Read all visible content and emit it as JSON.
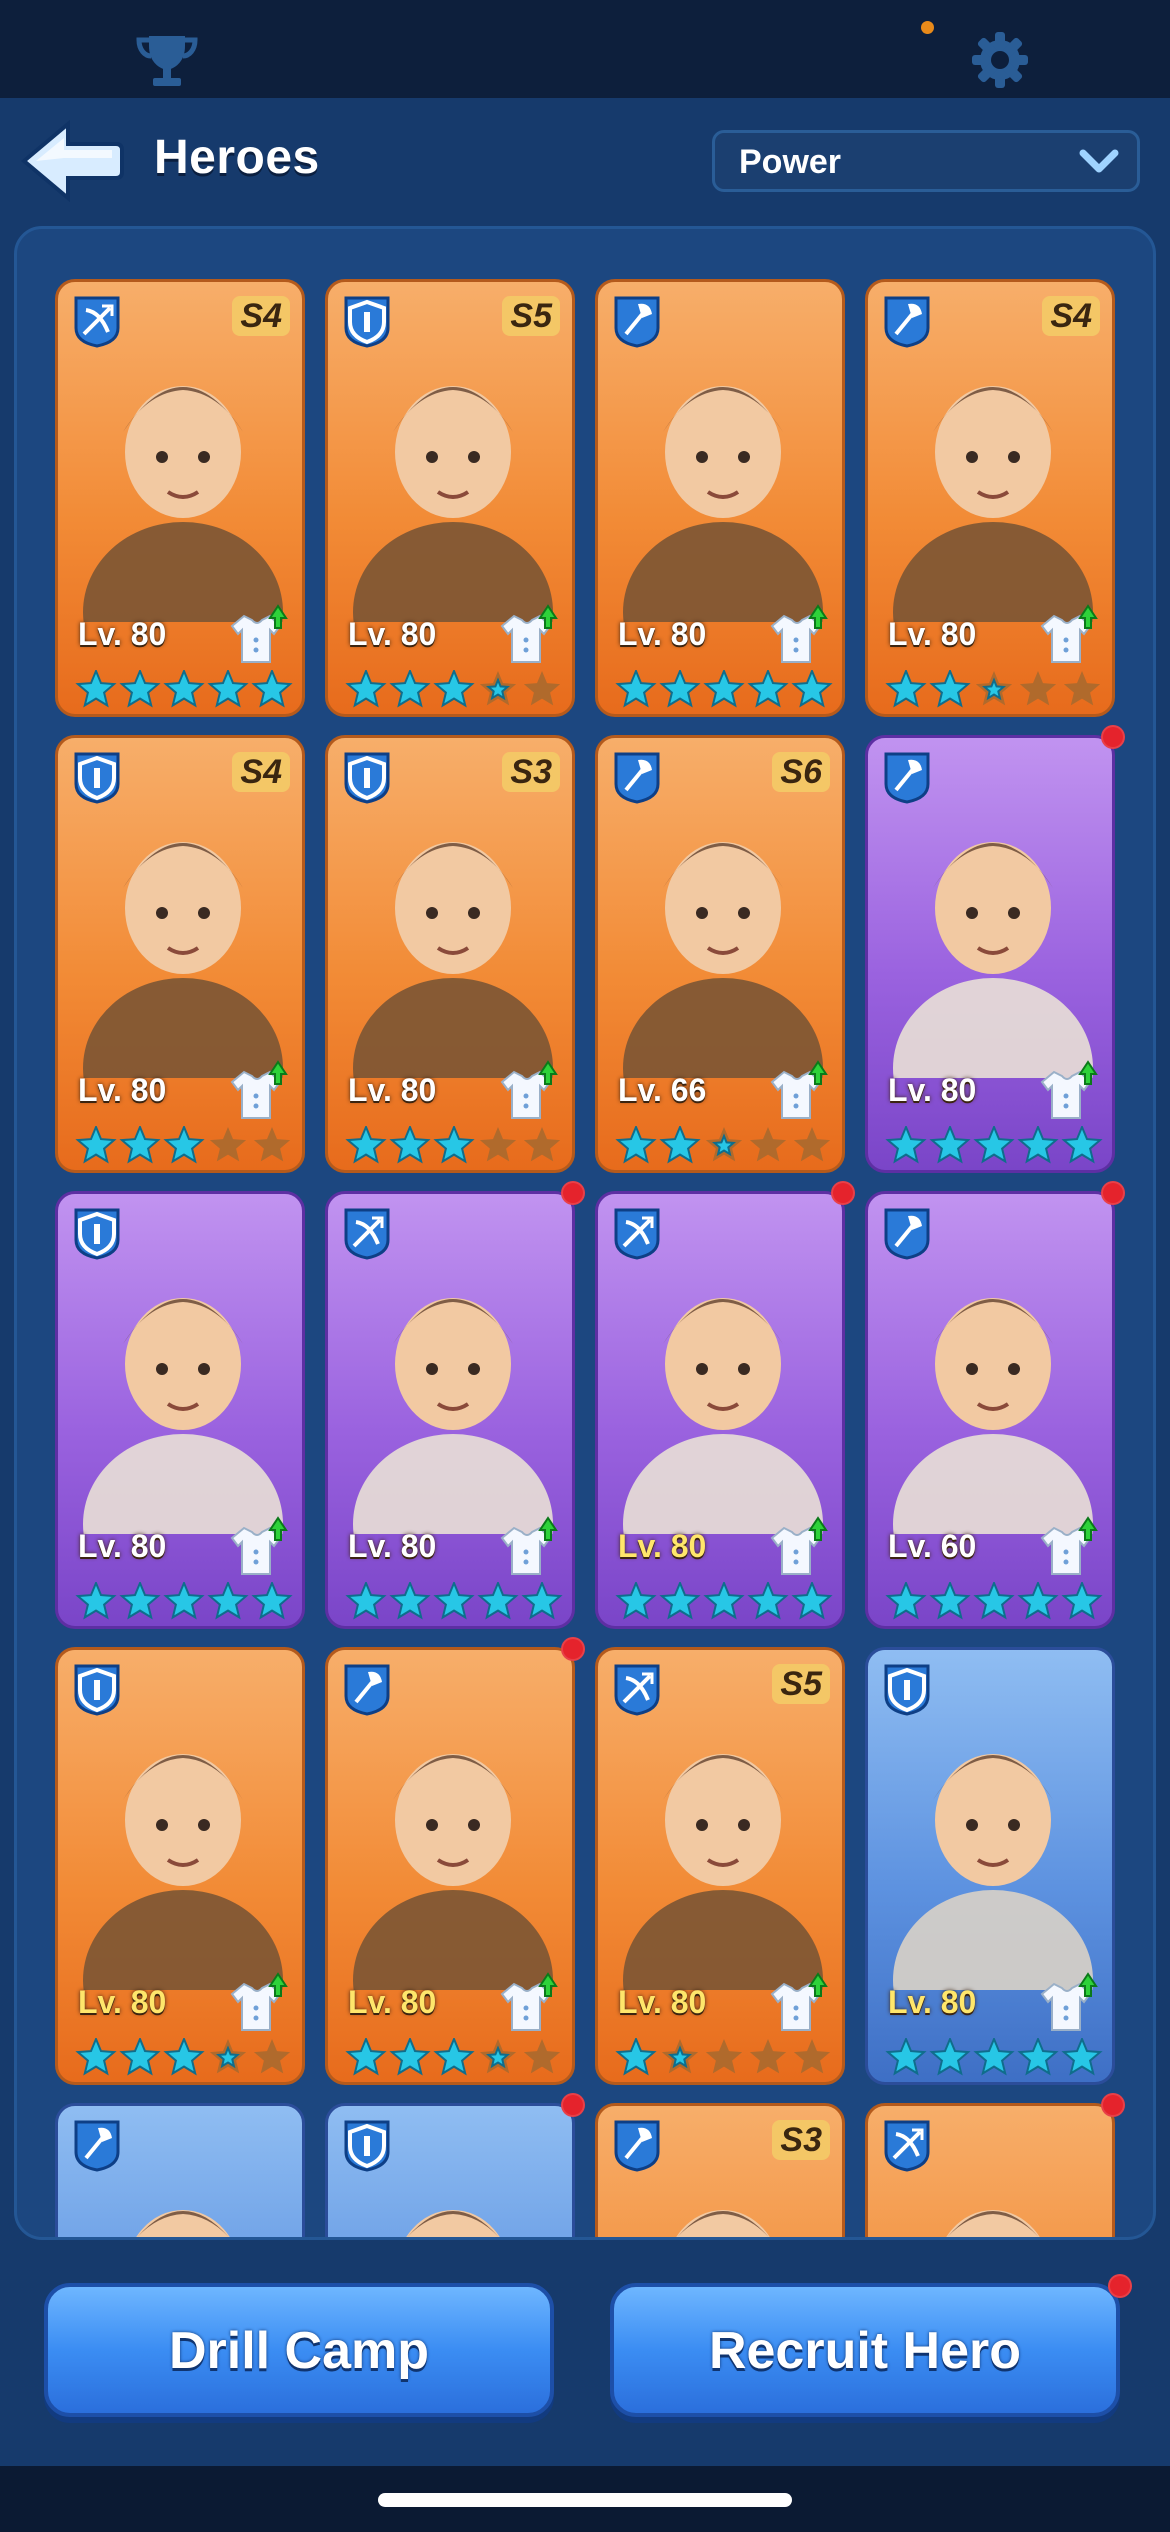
{
  "header": {
    "title": "Heroes",
    "sort_value": "Power"
  },
  "icons": {
    "trophy": "trophy-icon",
    "settings": "gear-icon",
    "back": "back-arrow-icon",
    "dropdown": "chevron-down-icon"
  },
  "heroes": [
    {
      "level": "Lv. 80",
      "grade": "S4",
      "role": "crossbow",
      "bg": "orange",
      "stars": 5,
      "gold": false,
      "dot": false
    },
    {
      "level": "Lv. 80",
      "grade": "S5",
      "role": "shield",
      "bg": "orange",
      "stars": 3.5,
      "gold": false,
      "dot": false
    },
    {
      "level": "Lv. 80",
      "grade": "",
      "role": "axe",
      "bg": "orange",
      "stars": 5,
      "gold": false,
      "dot": false
    },
    {
      "level": "Lv. 80",
      "grade": "S4",
      "role": "axe",
      "bg": "orange",
      "stars": 2.5,
      "gold": false,
      "dot": false
    },
    {
      "level": "Lv. 80",
      "grade": "S4",
      "role": "shield",
      "bg": "orange",
      "stars": 3,
      "gold": false,
      "dot": false
    },
    {
      "level": "Lv. 80",
      "grade": "S3",
      "role": "shield",
      "bg": "orange",
      "stars": 3,
      "gold": false,
      "dot": false
    },
    {
      "level": "Lv. 66",
      "grade": "S6",
      "role": "axe",
      "bg": "orange",
      "stars": 2.5,
      "gold": false,
      "dot": false
    },
    {
      "level": "Lv. 80",
      "grade": "",
      "role": "axe",
      "bg": "purple",
      "stars": 5,
      "gold": false,
      "dot": true
    },
    {
      "level": "Lv. 80",
      "grade": "",
      "role": "shield",
      "bg": "purple",
      "stars": 5,
      "gold": false,
      "dot": false
    },
    {
      "level": "Lv. 80",
      "grade": "",
      "role": "crossbow",
      "bg": "purple",
      "stars": 5,
      "gold": false,
      "dot": true
    },
    {
      "level": "Lv. 80",
      "grade": "",
      "role": "crossbow",
      "bg": "purple",
      "stars": 5,
      "gold": true,
      "dot": true
    },
    {
      "level": "Lv. 60",
      "grade": "",
      "role": "axe",
      "bg": "purple",
      "stars": 5,
      "gold": false,
      "dot": true
    },
    {
      "level": "Lv. 80",
      "grade": "",
      "role": "shield",
      "bg": "orange",
      "stars": 3.5,
      "gold": true,
      "dot": false
    },
    {
      "level": "Lv. 80",
      "grade": "",
      "role": "axe",
      "bg": "orange",
      "stars": 3.5,
      "gold": true,
      "dot": true
    },
    {
      "level": "Lv. 80",
      "grade": "S5",
      "role": "crossbow",
      "bg": "orange",
      "stars": 1.5,
      "gold": true,
      "dot": false
    },
    {
      "level": "Lv. 80",
      "grade": "",
      "role": "shield",
      "bg": "blue",
      "stars": 5,
      "gold": true,
      "dot": false
    },
    {
      "level": "",
      "grade": "",
      "role": "axe",
      "bg": "blue",
      "stars": 0,
      "gold": false,
      "dot": false
    },
    {
      "level": "",
      "grade": "",
      "role": "shield",
      "bg": "blue",
      "stars": 0,
      "gold": false,
      "dot": true
    },
    {
      "level": "",
      "grade": "S3",
      "role": "axe",
      "bg": "orange",
      "stars": 0,
      "gold": false,
      "dot": false
    },
    {
      "level": "",
      "grade": "",
      "role": "crossbow",
      "bg": "orange",
      "stars": 0,
      "gold": false,
      "dot": true
    }
  ],
  "buttons": {
    "drill_camp": "Drill Camp",
    "recruit_hero": "Recruit Hero"
  },
  "colors": {
    "star": "#27c7e6",
    "empty_star": "#b06a2c",
    "notification": "#e5232c"
  }
}
